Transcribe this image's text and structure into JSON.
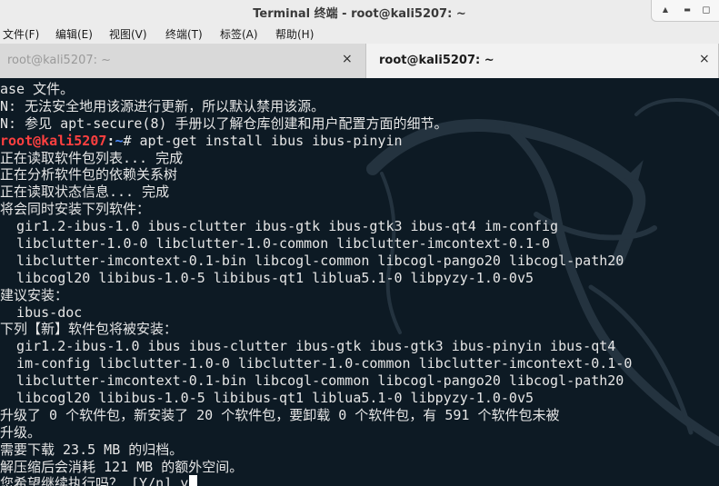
{
  "window": {
    "title": "Terminal 终端 - root@kali5207: ~",
    "buttons": {
      "up": "▲",
      "minimize": "▬",
      "maximize": "◻"
    }
  },
  "menu": {
    "items": [
      "文件(F)",
      "编辑(E)",
      "视图(V)",
      "终端(T)",
      "标签(A)",
      "帮助(H)"
    ]
  },
  "tabs": [
    {
      "label": "root@kali5207: ~",
      "active": false,
      "close": "×"
    },
    {
      "label": "root@kali5207: ~",
      "active": true,
      "close": "×"
    }
  ],
  "terminal": {
    "prompt": {
      "user_host": "root@kali5207",
      "colon": ":",
      "path": "~",
      "symbol": "# ",
      "command": "apt-get install ibus ibus-pinyin"
    },
    "lines_before_prompt": [
      "ase 文件。",
      "N: 无法安全地用该源进行更新，所以默认禁用该源。",
      "N: 参见 apt-secure(8) 手册以了解仓库创建和用户配置方面的细节。"
    ],
    "lines_after_prompt": [
      "正在读取软件包列表... 完成",
      "正在分析软件包的依赖关系树",
      "正在读取状态信息... 完成",
      "将会同时安装下列软件：",
      "  gir1.2-ibus-1.0 ibus-clutter ibus-gtk ibus-gtk3 ibus-qt4 im-config",
      "  libclutter-1.0-0 libclutter-1.0-common libclutter-imcontext-0.1-0",
      "  libclutter-imcontext-0.1-bin libcogl-common libcogl-pango20 libcogl-path20",
      "  libcogl20 libibus-1.0-5 libibus-qt1 liblua5.1-0 libpyzy-1.0-0v5",
      "建议安装：",
      "  ibus-doc",
      "下列【新】软件包将被安装：",
      "  gir1.2-ibus-1.0 ibus ibus-clutter ibus-gtk ibus-gtk3 ibus-pinyin ibus-qt4",
      "  im-config libclutter-1.0-0 libclutter-1.0-common libclutter-imcontext-0.1-0",
      "  libclutter-imcontext-0.1-bin libcogl-common libcogl-pango20 libcogl-path20",
      "  libcogl20 libibus-1.0-5 libibus-qt1 liblua5.1-0 libpyzy-1.0-0v5",
      "升级了 0 个软件包，新安装了 20 个软件包，要卸载 0 个软件包，有 591 个软件包未被",
      "升级。",
      "需要下载 23.5 MB 的归档。",
      "解压缩后会消耗 121 MB 的额外空间。"
    ],
    "input_line": {
      "question": "您希望继续执行吗？ [Y/n] ",
      "answer": "y"
    }
  },
  "colors": {
    "terminal_bg": "#0d1a24",
    "prompt_user": "#ff4040",
    "prompt_path": "#4e8cff",
    "text": "#e6e6e6"
  }
}
